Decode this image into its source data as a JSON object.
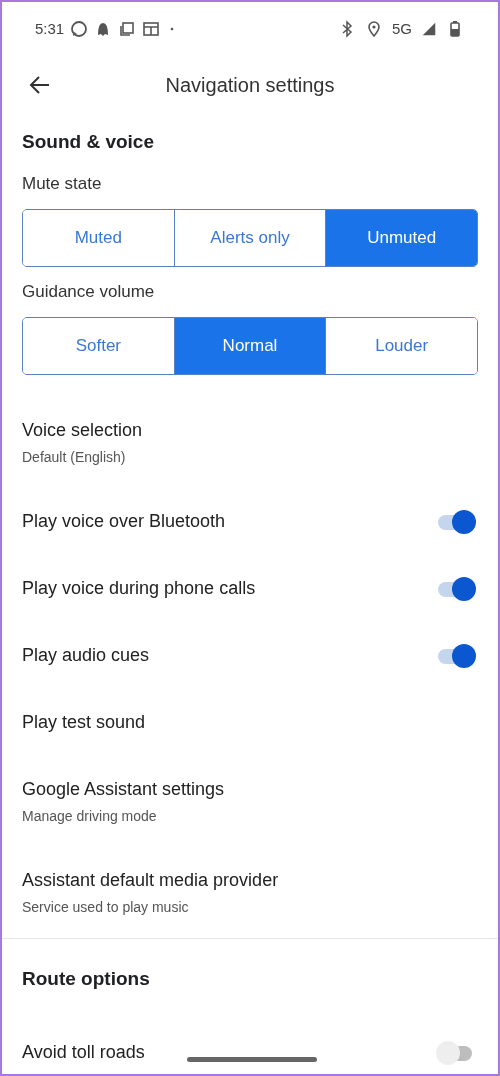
{
  "status_bar": {
    "time": "5:31",
    "network": "5G"
  },
  "app_bar": {
    "title": "Navigation settings"
  },
  "sections": [
    {
      "title": "Sound & voice",
      "items": [
        {
          "kind": "segmented",
          "label": "Mute state",
          "options": [
            {
              "label": "Muted",
              "selected": false
            },
            {
              "label": "Alerts only",
              "selected": false
            },
            {
              "label": "Unmuted",
              "selected": true
            }
          ]
        },
        {
          "kind": "segmented",
          "label": "Guidance volume",
          "options": [
            {
              "label": "Softer",
              "selected": false
            },
            {
              "label": "Normal",
              "selected": true
            },
            {
              "label": "Louder",
              "selected": false
            }
          ]
        },
        {
          "kind": "link",
          "title": "Voice selection",
          "subtitle": "Default (English)"
        },
        {
          "kind": "toggle",
          "title": "Play voice over Bluetooth",
          "on": true
        },
        {
          "kind": "toggle",
          "title": "Play voice during phone calls",
          "on": true
        },
        {
          "kind": "toggle",
          "title": "Play audio cues",
          "on": true
        },
        {
          "kind": "link",
          "title": "Play test sound"
        },
        {
          "kind": "link",
          "title": "Google Assistant settings",
          "subtitle": "Manage driving mode"
        },
        {
          "kind": "link",
          "title": "Assistant default media provider",
          "subtitle": "Service used to play music"
        }
      ]
    },
    {
      "title": "Route options",
      "items": [
        {
          "kind": "toggle",
          "title": "Avoid toll roads",
          "on": false
        }
      ]
    }
  ]
}
